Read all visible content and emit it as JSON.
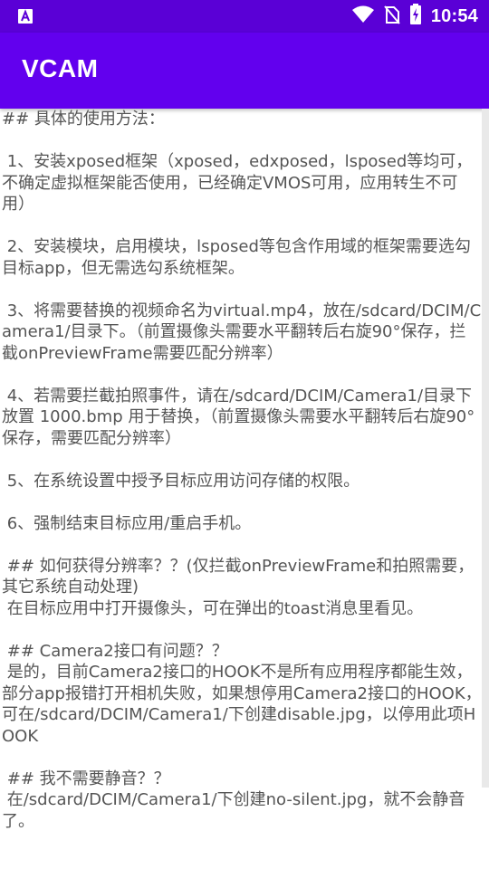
{
  "status_bar": {
    "time": "10:54",
    "icons": [
      "android-a-icon",
      "wifi-icon",
      "no-sim-icon",
      "battery-charging-icon"
    ]
  },
  "app_bar": {
    "title": "VCAM"
  },
  "content": {
    "text": "## 具体的使用方法：\n\n 1、安装xposed框架（xposed，edxposed，lsposed等均可，不确定虚拟框架能否使用，已经确定VMOS可用，应用转生不可用）\n\n 2、安装模块，启用模块，lsposed等包含作用域的框架需要选勾目标app，但无需选勾系统框架。\n\n 3、将需要替换的视频命名为virtual.mp4，放在/sdcard/DCIM/Camera1/目录下。（前置摄像头需要水平翻转后右旋90°保存，拦截onPreviewFrame需要匹配分辨率）\n\n 4、若需要拦截拍照事件，请在/sdcard/DCIM/Camera1/目录下放置 1000.bmp 用于替换，（前置摄像头需要水平翻转后右旋90°保存，需要匹配分辨率）\n\n 5、在系统设置中授予目标应用访问存储的权限。\n\n 6、强制结束目标应用/重启手机。\n\n ## 如何获得分辨率？？(仅拦截onPreviewFrame和拍照需要，其它系统自动处理)\n 在目标应用中打开摄像头，可在弹出的toast消息里看见。\n\n ## Camera2接口有问题？？\n 是的，目前Camera2接口的HOOK不是所有应用程序都能生效，部分app报错打开相机失败，如果想停用Camera2接口的HOOK，可在/sdcard/DCIM/Camera1/下创建disable.jpg，以停用此项HOOK\n\n ## 我不需要静音？？\n 在/sdcard/DCIM/Camera1/下创建no-silent.jpg，就不会静音了。"
  },
  "colors": {
    "status_bar": "#5a00d6",
    "app_bar": "#6200ee",
    "text": "#555555"
  }
}
